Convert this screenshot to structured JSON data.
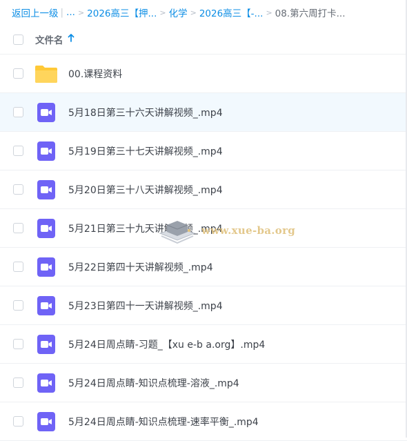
{
  "breadcrumb": {
    "back_label": "返回上一级",
    "pipe": "|",
    "ellipsis": "...",
    "separator": ">",
    "items": [
      "2026高三【押...",
      "化学",
      "2026高三【-..."
    ],
    "current": "08.第六周打卡..."
  },
  "table": {
    "column_name": "文件名",
    "sort": "ascending"
  },
  "files": [
    {
      "name": "00.课程资料",
      "type": "folder",
      "icon": "folder-icon"
    },
    {
      "name": "5月18日第三十六天讲解视频_.mp4",
      "type": "video",
      "icon": "video-file-icon",
      "hover": true
    },
    {
      "name": "5月19日第三十七天讲解视频_.mp4",
      "type": "video",
      "icon": "video-file-icon"
    },
    {
      "name": "5月20日第三十八天讲解视频_.mp4",
      "type": "video",
      "icon": "video-file-icon"
    },
    {
      "name": "5月21日第三十九天讲解视频_.mp4",
      "type": "video",
      "icon": "video-file-icon"
    },
    {
      "name": "5月22日第四十天讲解视频_.mp4",
      "type": "video",
      "icon": "video-file-icon"
    },
    {
      "name": "5月23日第四十一天讲解视频_.mp4",
      "type": "video",
      "icon": "video-file-icon"
    },
    {
      "name": "5月24日周点睛-习题_【xu e-b a.org】.mp4",
      "type": "video",
      "icon": "video-file-icon"
    },
    {
      "name": "5月24日周点睛-知识点梳理-溶液_.mp4",
      "type": "video",
      "icon": "video-file-icon"
    },
    {
      "name": "5月24日周点睛-知识点梳理-速率平衡_.mp4",
      "type": "video",
      "icon": "video-file-icon"
    }
  ],
  "watermark": {
    "text": "www.xue-ba.org"
  },
  "colors": {
    "accent": "#0b8de5",
    "folder": "#ffc937",
    "video": "#6f63f6",
    "row_selected": "#f2f9fe"
  }
}
